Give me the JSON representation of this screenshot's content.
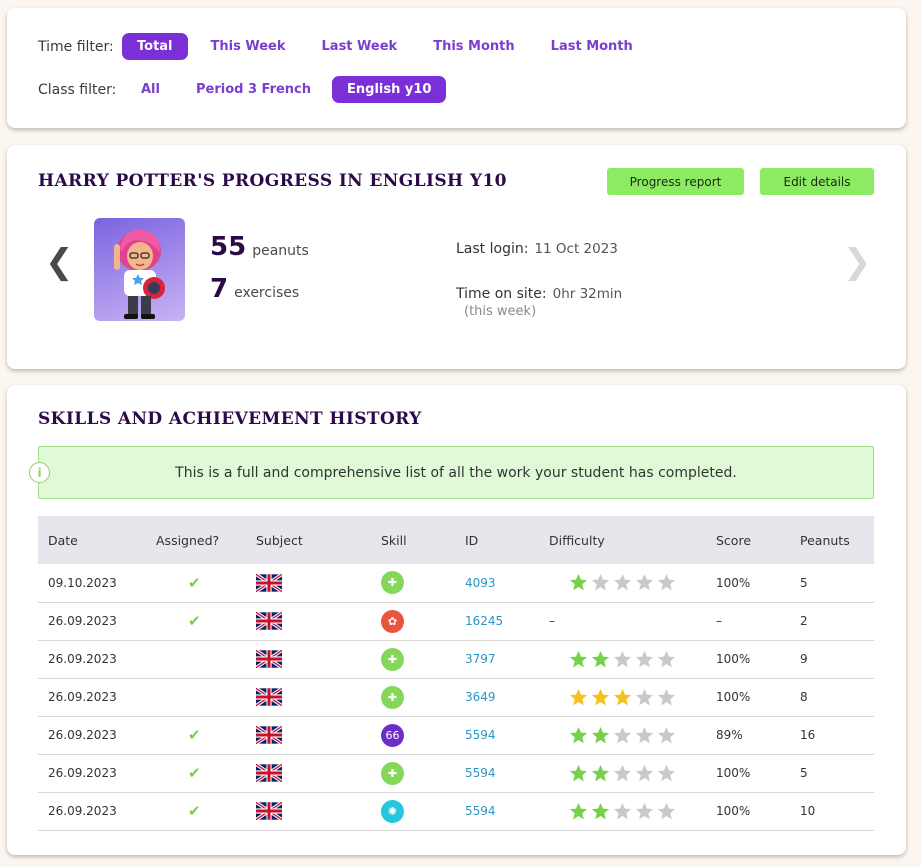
{
  "filters": {
    "time_label": "Time filter:",
    "time_options": [
      "Total",
      "This Week",
      "Last Week",
      "This Month",
      "Last Month"
    ],
    "time_selected": "Total",
    "class_label": "Class filter:",
    "class_options": [
      "All",
      "Period 3 French",
      "English y10"
    ],
    "class_selected": "English y10"
  },
  "profile": {
    "title": "HARRY POTTER'S PROGRESS IN ENGLISH Y10",
    "progress_report_label": "Progress report",
    "edit_details_label": "Edit details",
    "prev_arrow": "❮",
    "next_arrow": "❯",
    "peanuts_value": "55",
    "peanuts_unit": "peanuts",
    "exercises_value": "7",
    "exercises_unit": "exercises",
    "last_login_label": "Last login:",
    "last_login_value": "11 Oct 2023",
    "time_on_site_label": "Time on site:",
    "time_on_site_value": "0hr 32min",
    "time_on_site_note": "(this week)"
  },
  "history": {
    "title": "SKILLS AND ACHIEVEMENT HISTORY",
    "notice": "This is a full and comprehensive list of all the work your student has completed.",
    "columns": [
      "Date",
      "Assigned?",
      "Subject",
      "Skill",
      "ID",
      "Difficulty",
      "Score",
      "Peanuts"
    ],
    "rows": [
      {
        "date": "09.10.2023",
        "assigned": true,
        "skill": "puzzle-icon",
        "skill_color": "#86d65c",
        "id": "4093",
        "difficulty": 1,
        "star_color": "#76d04a",
        "score": "100%",
        "peanuts": "5"
      },
      {
        "date": "26.09.2023",
        "assigned": true,
        "skill": "brain-icon",
        "skill_color": "#e8543d",
        "id": "16245",
        "difficulty": null,
        "diff_text": "–",
        "score": "–",
        "peanuts": "2"
      },
      {
        "date": "26.09.2023",
        "assigned": false,
        "skill": "puzzle-icon",
        "skill_color": "#86d65c",
        "id": "3797",
        "difficulty": 2,
        "star_color": "#76d04a",
        "score": "100%",
        "peanuts": "9"
      },
      {
        "date": "26.09.2023",
        "assigned": false,
        "skill": "puzzle-icon",
        "skill_color": "#86d65c",
        "id": "3649",
        "difficulty": 3,
        "star_color": "#f3c21c",
        "score": "100%",
        "peanuts": "8"
      },
      {
        "date": "26.09.2023",
        "assigned": true,
        "skill": "quote-icon",
        "skill_color": "#6b2fc6",
        "id": "5594",
        "difficulty": 2,
        "star_color": "#76d04a",
        "score": "89%",
        "peanuts": "16"
      },
      {
        "date": "26.09.2023",
        "assigned": true,
        "skill": "puzzle-icon",
        "skill_color": "#86d65c",
        "id": "5594",
        "difficulty": 2,
        "star_color": "#76d04a",
        "score": "100%",
        "peanuts": "5"
      },
      {
        "date": "26.09.2023",
        "assigned": true,
        "skill": "lightbulb-icon",
        "skill_color": "#25c7dc",
        "id": "5594",
        "difficulty": 2,
        "star_color": "#76d04a",
        "score": "100%",
        "peanuts": "10"
      }
    ]
  },
  "colors": {
    "accent": "#7b2fd6",
    "button_green": "#8ceb62",
    "title": "#2c0a4a",
    "link": "#2a95c6"
  }
}
